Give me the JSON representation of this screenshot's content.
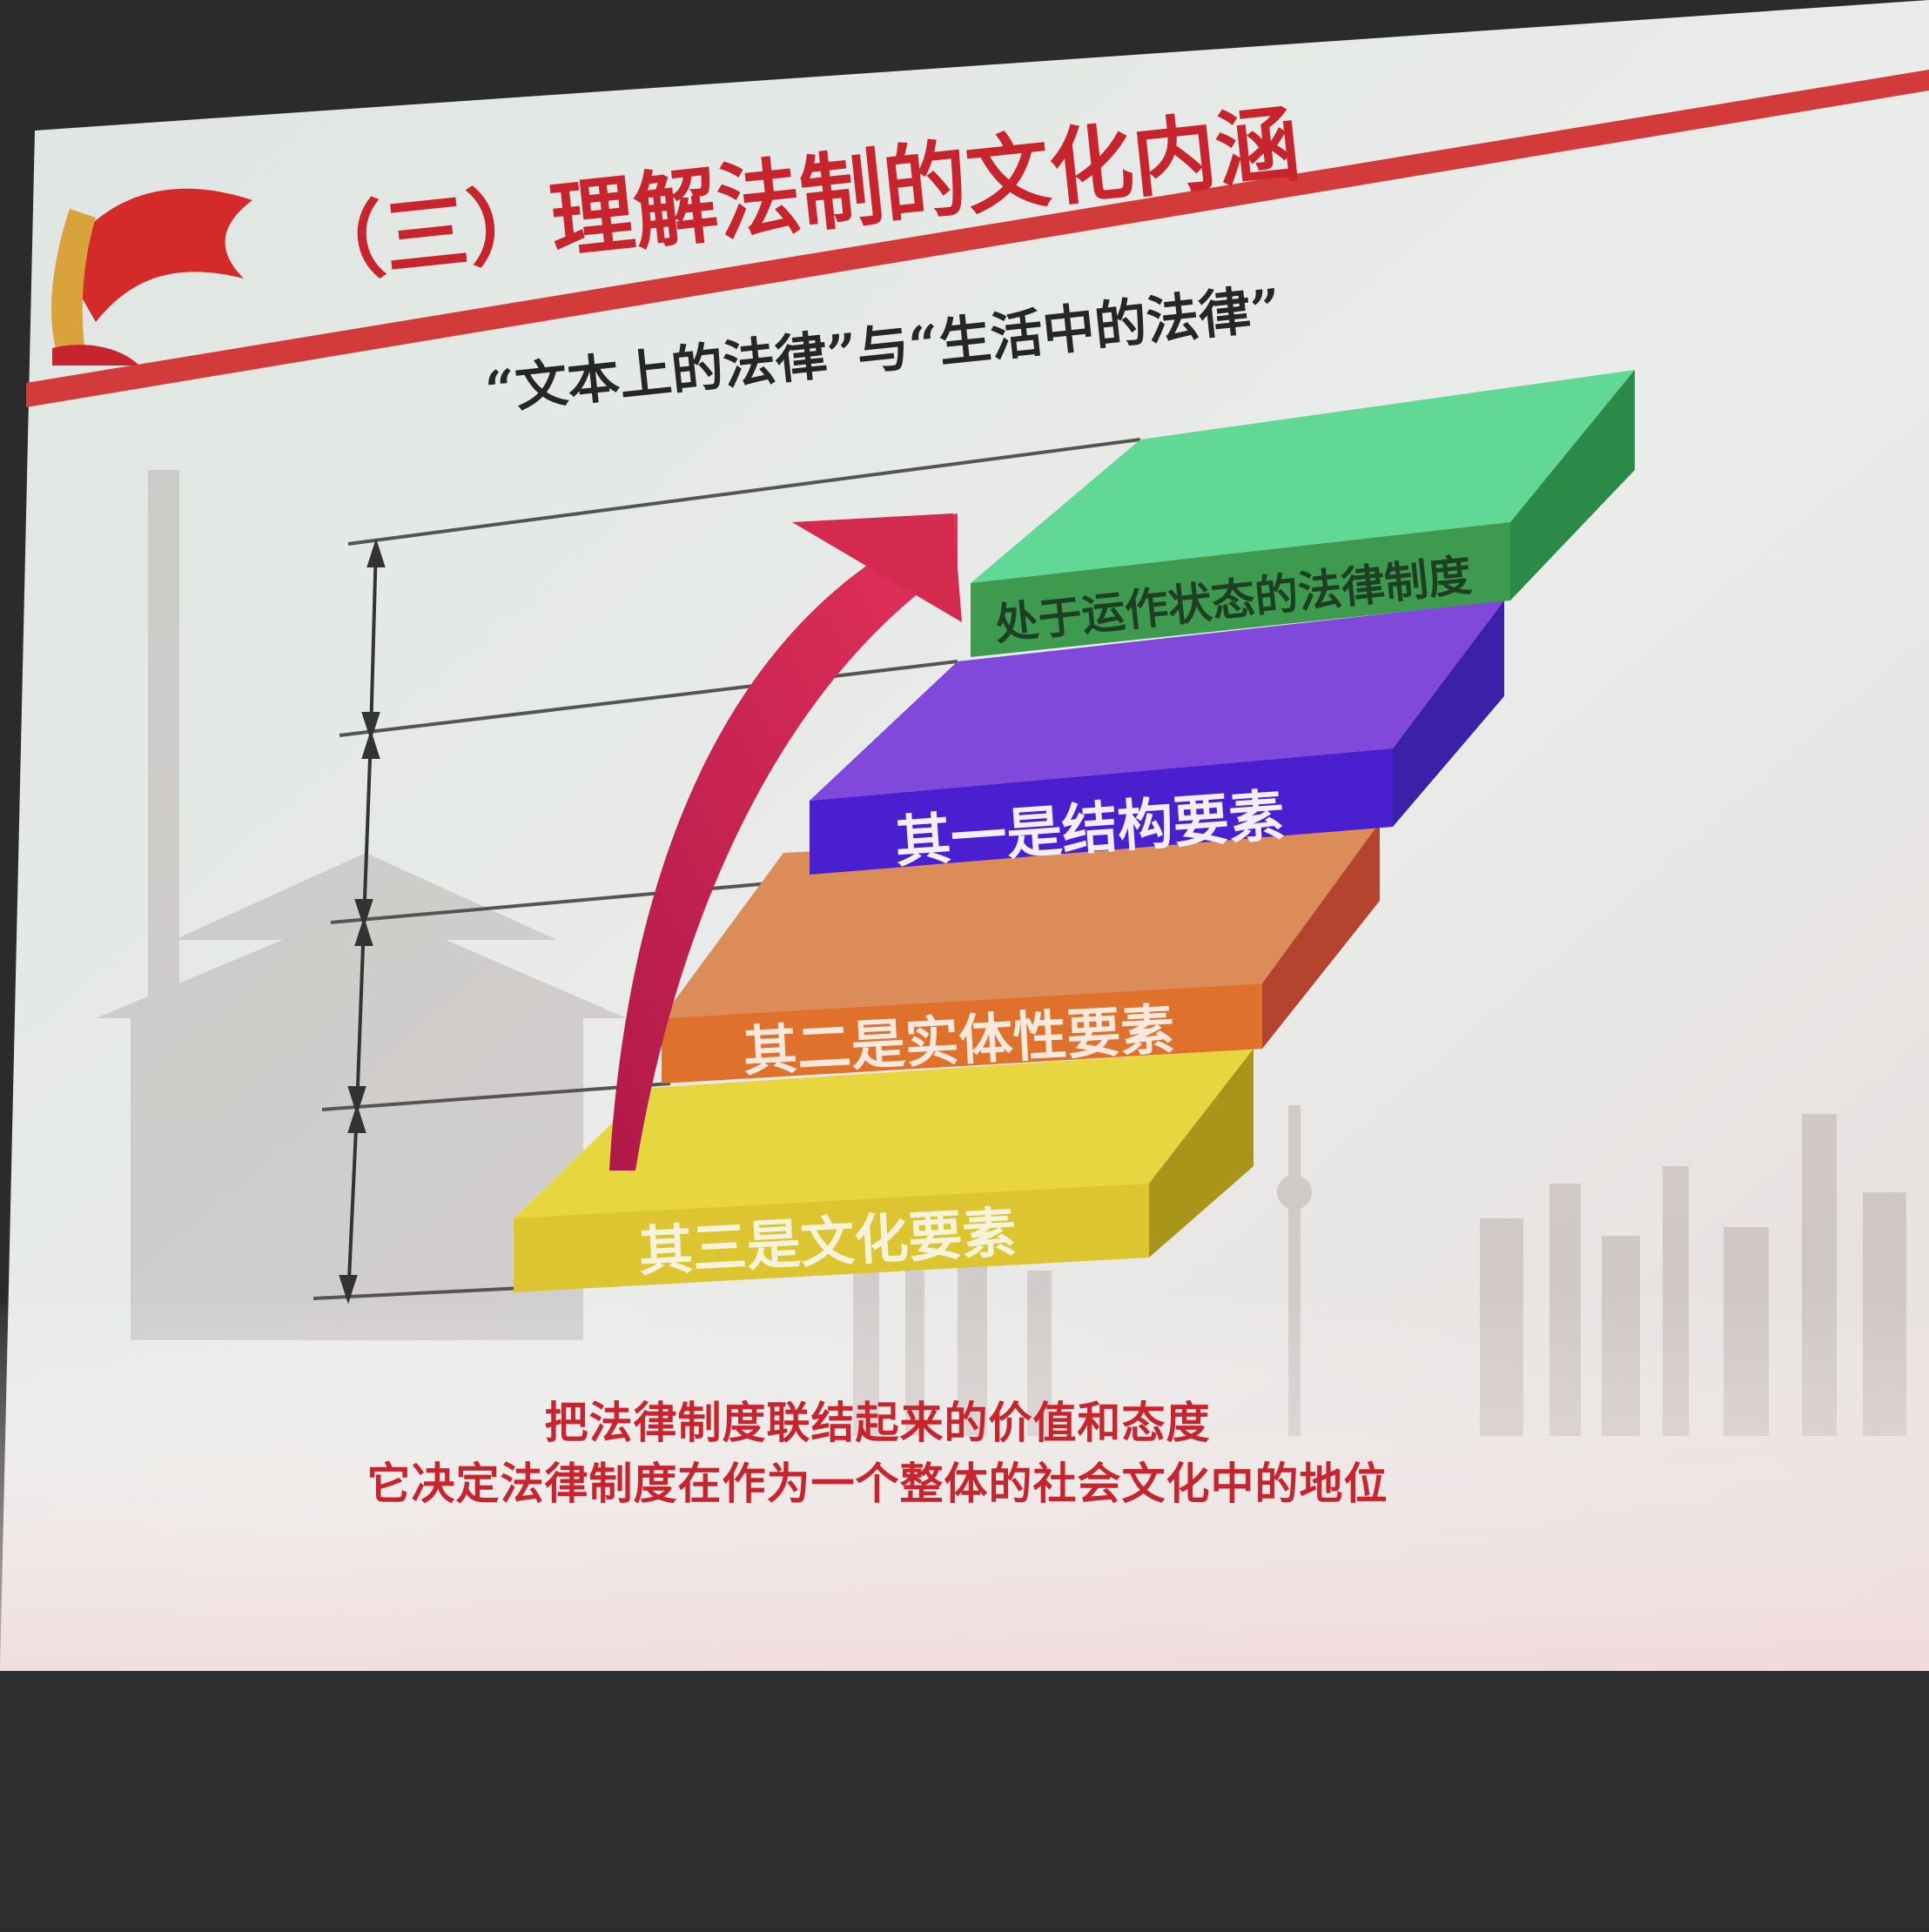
{
  "slide": {
    "title": "（三）理解法制的文化内涵",
    "subtitle": "“文本上的法律”与“生活中的法律”",
    "accent_color": "#c8242e",
    "icon": "red-flag-emblem-icon"
  },
  "diagram": {
    "type": "stacked-steps",
    "steps": [
      {
        "label": "处于运作状态的法律制度",
        "color": "#5fd491",
        "label_color": "#1d3f24"
      },
      {
        "label": "其一是结构要素",
        "color": "#7a3ed8",
        "label_color": "#ffffff"
      },
      {
        "label": "其二是实体性要素",
        "color": "#d9824a",
        "label_color": "#ffffff"
      },
      {
        "label": "其三是文化要素",
        "color": "#e3cf32",
        "label_color": "#ffffff"
      }
    ],
    "arrow": "up-curved-arrow-icon"
  },
  "caption": {
    "line1": "把法律制度联结起来的价值和态度",
    "line2": "它决定法律制度在作为一个整体的社会文化中的地位"
  }
}
